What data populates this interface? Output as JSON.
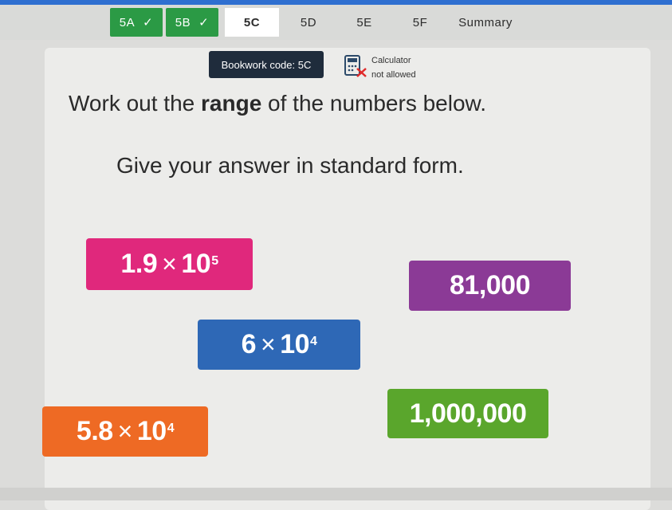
{
  "tabs": [
    {
      "label": "5A",
      "done": true
    },
    {
      "label": "5B",
      "done": true
    },
    {
      "label": "5C",
      "active": true
    },
    {
      "label": "5D"
    },
    {
      "label": "5E"
    },
    {
      "label": "5F"
    },
    {
      "label": "Summary"
    }
  ],
  "check_glyph": "✓",
  "bookwork": {
    "text": "Bookwork code: 5C"
  },
  "calculator": {
    "line1": "Calculator",
    "line2": "not allowed",
    "icon": "calculator-crossed-icon"
  },
  "question": {
    "line1_before": "Work out the ",
    "line1_bold": "range",
    "line1_after": " of the numbers below.",
    "line2": "Give your answer in standard form."
  },
  "numbers": {
    "pink": {
      "mantissa": "1.9",
      "times": "×",
      "base": "10",
      "exp": "5"
    },
    "purple": {
      "value": "81,000"
    },
    "blue": {
      "mantissa": "6",
      "times": "×",
      "base": "10",
      "exp": "4"
    },
    "orange": {
      "mantissa": "5.8",
      "times": "×",
      "base": "10",
      "exp": "4"
    },
    "green": {
      "value": "1,000,000"
    }
  },
  "colors": {
    "pink": "#e0287c",
    "purple": "#8b3a96",
    "blue": "#2e68b6",
    "orange": "#ee6a24",
    "green": "#5aa62c",
    "tab_done": "#2b9a45"
  }
}
